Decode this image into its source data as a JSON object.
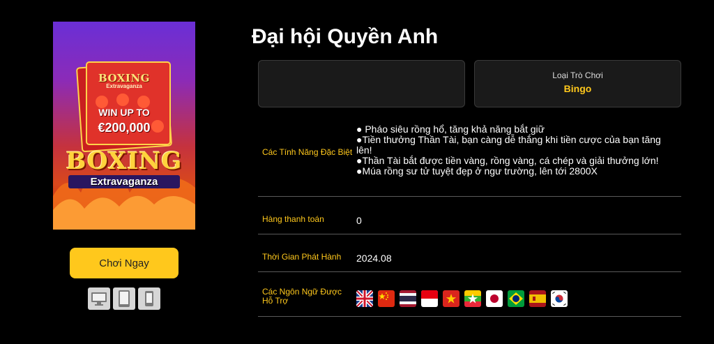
{
  "cover": {
    "title_top": "BOXING",
    "title_top_sub": "Extravaganza",
    "win_line": "WIN UP TO",
    "amount": "€200,000",
    "big_title": "BOXING",
    "big_sub": "Extravaganza"
  },
  "actions": {
    "play_label": "Chơi Ngay"
  },
  "devices": [
    "desktop-icon",
    "tablet-icon",
    "mobile-icon"
  ],
  "game": {
    "title": "Đại hội Quyền Anh",
    "type_label": "Loại Trò Chơi",
    "type_value": "Bingo"
  },
  "details": {
    "features_label": "Các Tính Năng Đặc Biệt",
    "features": [
      "● Pháo siêu rồng hổ, tăng khả năng bắt giữ",
      "●Tiền thưởng Thần Tài, bạn càng dễ thắng khi tiền cược của bạn tăng lên!",
      "●Thần Tài bắt được tiền vàng, rồng vàng, cá chép và giải thưởng lớn!",
      "●Múa rồng sư tử tuyệt đẹp ở ngư trường, lên tới 2800X"
    ],
    "paylines_label": "Hàng thanh toán",
    "paylines_value": "0",
    "release_label": "Thời Gian Phát Hành",
    "release_value": "2024.08",
    "languages_label": "Các Ngôn Ngữ Được Hỗ Trợ",
    "languages": [
      "uk-flag-icon",
      "china-flag-icon",
      "thailand-flag-icon",
      "indonesia-flag-icon",
      "vietnam-flag-icon",
      "myanmar-flag-icon",
      "japan-flag-icon",
      "brazil-flag-icon",
      "spain-flag-icon",
      "korea-flag-icon"
    ]
  },
  "colors": {
    "accent": "#ffc81c",
    "background": "#000000",
    "panel": "#1a1a1a"
  }
}
